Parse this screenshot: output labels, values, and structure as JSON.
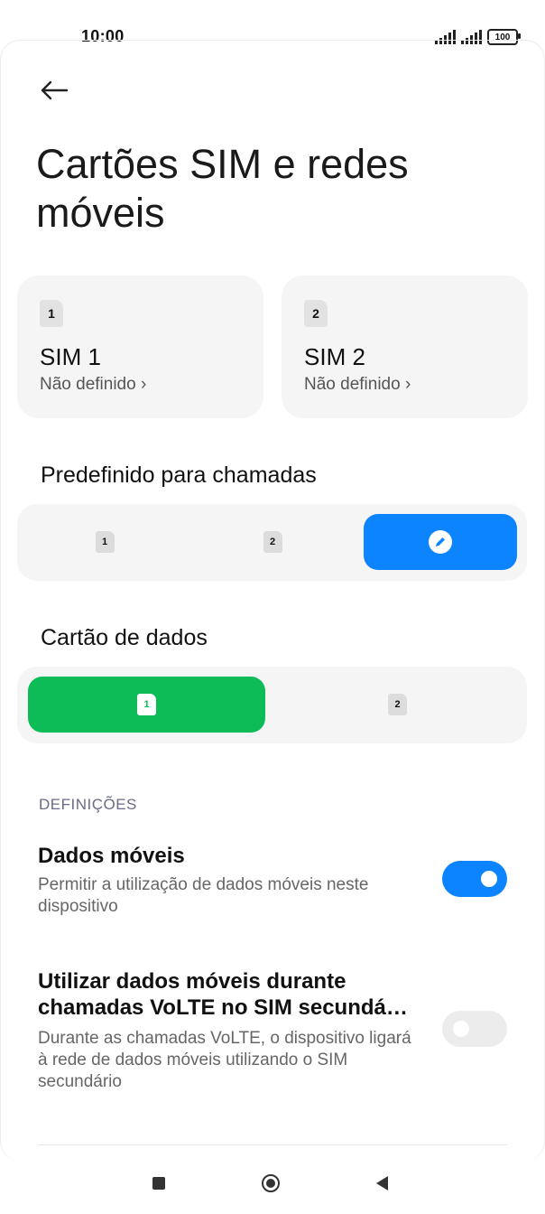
{
  "status_bar": {
    "time": "10:00",
    "battery": "100"
  },
  "header": {
    "title": "Cartões SIM e redes móveis"
  },
  "sim_cards": [
    {
      "badge": "1",
      "name": "SIM 1",
      "status": "Não definido ›"
    },
    {
      "badge": "2",
      "name": "SIM 2",
      "status": "Não definido ›"
    }
  ],
  "calls": {
    "label": "Predefinido para chamadas",
    "options": [
      {
        "badge": "1",
        "selected": false
      },
      {
        "badge": "2",
        "selected": false
      },
      {
        "icon": "pencil-icon",
        "selected": true
      }
    ]
  },
  "data_card": {
    "label": "Cartão de dados",
    "options": [
      {
        "badge": "1",
        "selected": true
      },
      {
        "badge": "2",
        "selected": false
      }
    ]
  },
  "settings": {
    "header": "DEFINIÇÕES",
    "mobile_data": {
      "title": "Dados móveis",
      "description": "Permitir a utilização de dados móveis neste dispositivo",
      "enabled": true
    },
    "volte_data": {
      "title": "Utilizar dados móveis durante chamadas VoLTE no SIM secundá…",
      "description": "Durante as chamadas VoLTE, o dispositivo ligará à rede de dados móveis utilizando o SIM secundário",
      "enabled": false
    }
  },
  "colors": {
    "accent_blue": "#0d84ff",
    "accent_green": "#0dbb57",
    "card_bg": "#f5f5f5"
  }
}
